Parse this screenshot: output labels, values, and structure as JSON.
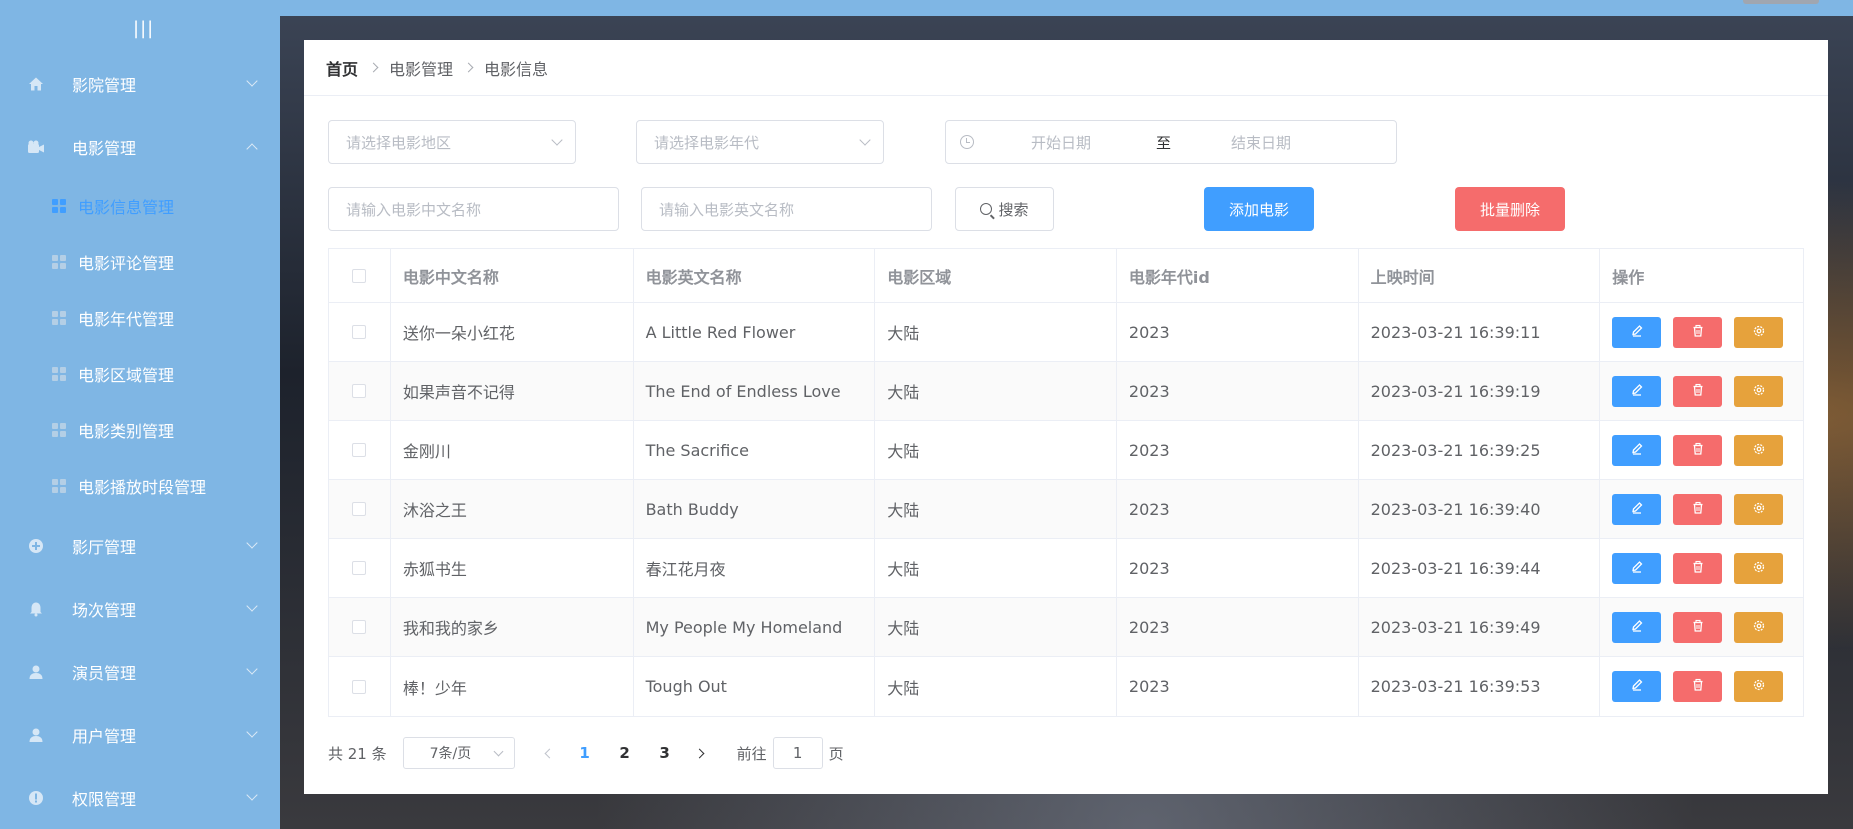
{
  "sidebar": {
    "collapse_glyph": "|||",
    "menus": [
      {
        "label": "影院管理",
        "icon": "home-icon",
        "expanded": false
      },
      {
        "label": "电影管理",
        "icon": "video-camera-icon",
        "expanded": true,
        "children": [
          {
            "label": "电影信息管理",
            "active": true
          },
          {
            "label": "电影评论管理",
            "active": false
          },
          {
            "label": "电影年代管理",
            "active": false
          },
          {
            "label": "电影区域管理",
            "active": false
          },
          {
            "label": "电影类别管理",
            "active": false
          },
          {
            "label": "电影播放时段管理",
            "active": false
          }
        ]
      },
      {
        "label": "影厅管理",
        "icon": "circle-plus-icon",
        "expanded": false
      },
      {
        "label": "场次管理",
        "icon": "bell-icon",
        "expanded": false
      },
      {
        "label": "演员管理",
        "icon": "user-icon",
        "expanded": false
      },
      {
        "label": "用户管理",
        "icon": "user-icon",
        "expanded": false
      },
      {
        "label": "权限管理",
        "icon": "warning-icon",
        "expanded": false
      }
    ]
  },
  "breadcrumb": {
    "home": "首页",
    "level1": "电影管理",
    "level2": "电影信息"
  },
  "filters": {
    "region_placeholder": "请选择电影地区",
    "era_placeholder": "请选择电影年代",
    "start_date_placeholder": "开始日期",
    "range_separator": "至",
    "end_date_placeholder": "结束日期",
    "cn_name_placeholder": "请输入电影中文名称",
    "en_name_placeholder": "请输入电影英文名称",
    "search_label": "搜索",
    "add_label": "添加电影",
    "batch_delete_label": "批量删除"
  },
  "table": {
    "headers": [
      "电影中文名称",
      "电影英文名称",
      "电影区域",
      "电影年代id",
      "上映时间",
      "操作"
    ],
    "rows": [
      {
        "cn": "送你一朵小红花",
        "en": "A Little Red Flower",
        "region": "大陆",
        "era": "2023",
        "time": "2023-03-21 16:39:11"
      },
      {
        "cn": "如果声音不记得",
        "en": "The End of Endless Love",
        "region": "大陆",
        "era": "2023",
        "time": "2023-03-21 16:39:19"
      },
      {
        "cn": "金刚川",
        "en": "The Sacrifice",
        "region": "大陆",
        "era": "2023",
        "time": "2023-03-21 16:39:25"
      },
      {
        "cn": "沐浴之王",
        "en": "Bath Buddy",
        "region": "大陆",
        "era": "2023",
        "time": "2023-03-21 16:39:40"
      },
      {
        "cn": "赤狐书生",
        "en": "春江花月夜",
        "region": "大陆",
        "era": "2023",
        "time": "2023-03-21 16:39:44"
      },
      {
        "cn": "我和我的家乡",
        "en": "My People My Homeland",
        "region": "大陆",
        "era": "2023",
        "time": "2023-03-21 16:39:49"
      },
      {
        "cn": "棒！少年",
        "en": "Tough Out",
        "region": "大陆",
        "era": "2023",
        "time": "2023-03-21 16:39:53"
      }
    ],
    "action_icons": [
      "edit-icon",
      "delete-icon",
      "settings-icon"
    ]
  },
  "pagination": {
    "total": "共 21 条",
    "page_size": "7条/页",
    "pages": [
      "1",
      "2",
      "3"
    ],
    "current_page": "1",
    "goto_label": "前往",
    "goto_value": "1",
    "page_suffix": "页"
  },
  "colors": {
    "sidebar": "#7fb6e4",
    "primary": "#409eff",
    "danger": "#f56c6c",
    "warning": "#e6a23c"
  }
}
